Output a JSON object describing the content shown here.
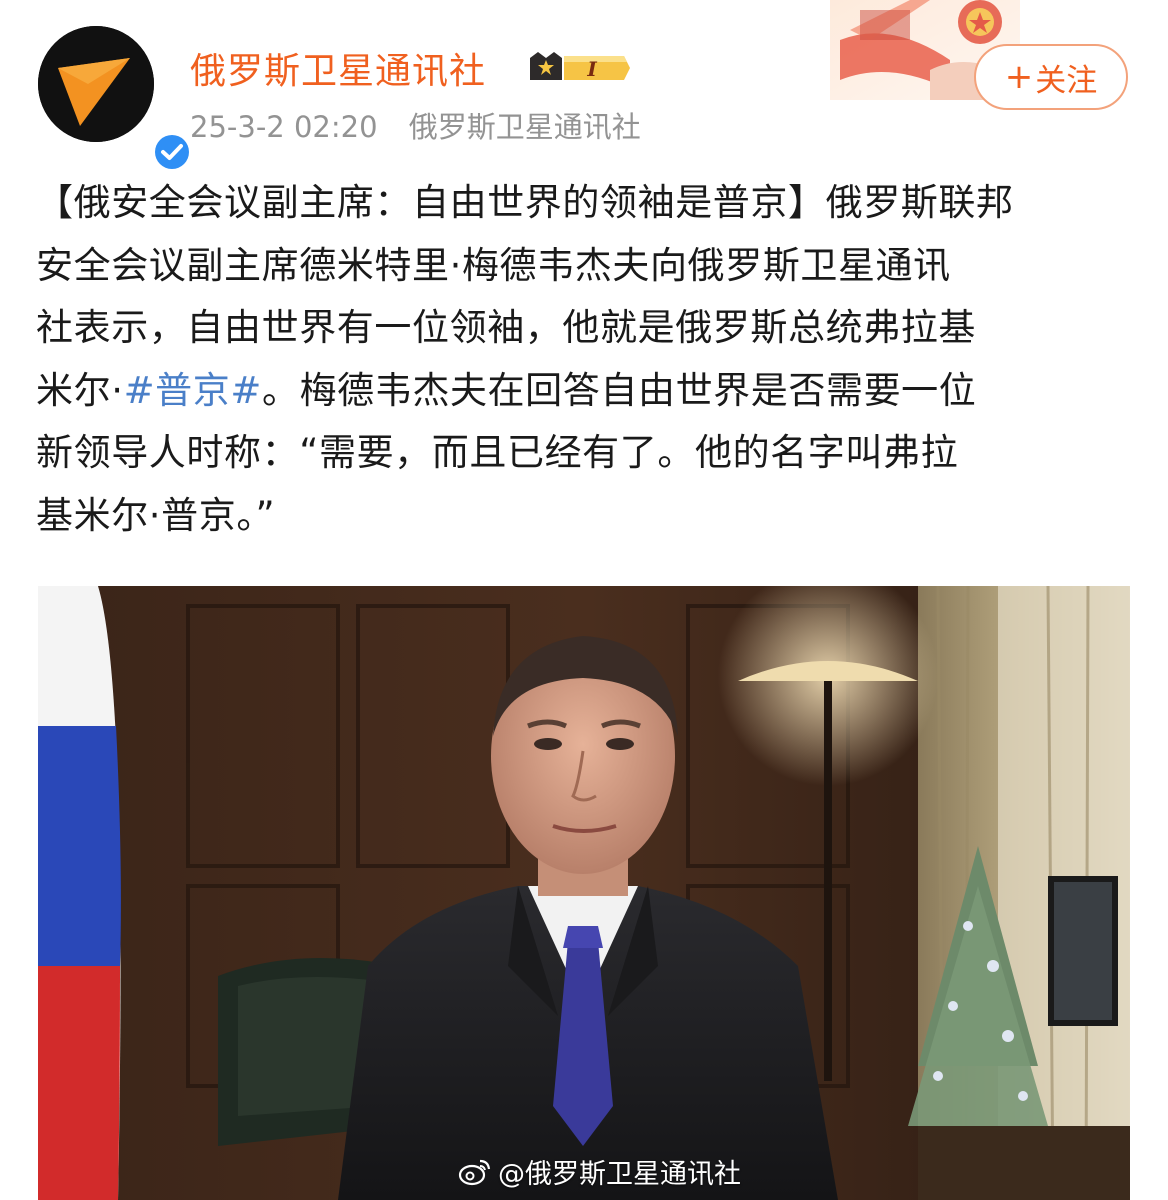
{
  "post": {
    "account_name": "俄罗斯卫星通讯社",
    "vip_badge_level": "I",
    "timestamp": "25-3-2 02:20",
    "source": "俄罗斯卫星通讯社",
    "follow_label": "关注",
    "follow_plus": "+",
    "text_lines": [
      "【俄安全会议副主席：自由世界的领袖是普京】俄罗斯联邦",
      "安全会议副主席德米特里·梅德韦杰夫向俄罗斯卫星通讯",
      "社表示，自由世界有一位领袖，他就是俄罗斯总统弗拉基"
    ],
    "line4_prefix": "米尔·",
    "hashtag": "#普京#",
    "line4_suffix": "。梅德韦杰夫在回答自由世界是否需要一位",
    "text_lines_after": [
      "新领导人时称：“需要，而且已经有了。他的名字叫弗拉",
      "基米尔·普京。”"
    ],
    "image_watermark": "@俄罗斯卫星通讯社"
  },
  "colors": {
    "accent": "#f0601f",
    "hashtag": "#4a7fc8",
    "meta": "#939393",
    "verified": "#2f8ff5"
  },
  "icons": {
    "avatar": "sputnik-logo-icon",
    "verified": "verified-check-icon",
    "badge": "crown-badge-icon",
    "watermark": "weibo-logo-icon"
  }
}
